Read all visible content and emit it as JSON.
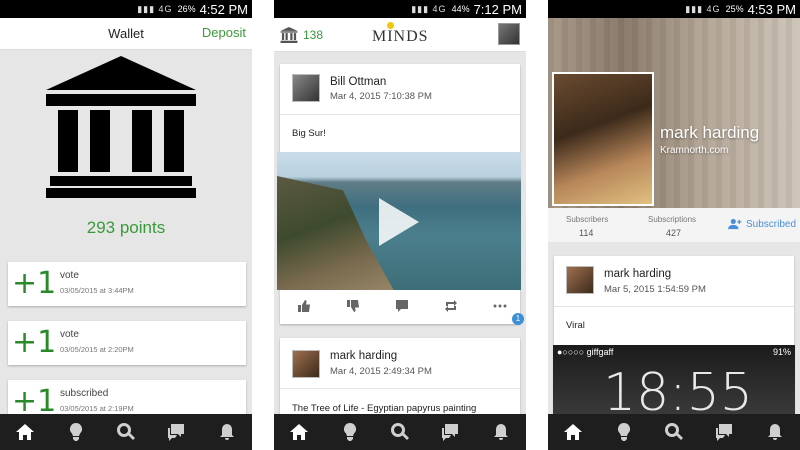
{
  "phones": [
    {
      "status": {
        "battery": "26%",
        "time": "4:52 PM"
      },
      "header": {
        "title": "Wallet",
        "deposit_label": "Deposit"
      },
      "points": "293 points",
      "transactions": [
        {
          "amount": "+1",
          "label": "vote",
          "date": "03/05/2015 at 3:44PM"
        },
        {
          "amount": "+1",
          "label": "vote",
          "date": "03/05/2015 at 2:20PM"
        },
        {
          "amount": "+1",
          "label": "subscribed",
          "date": "03/05/2015 at 2:19PM"
        }
      ]
    },
    {
      "status": {
        "battery": "44%",
        "time": "7:12 PM"
      },
      "header": {
        "points_count": "138",
        "logo": "MINDS"
      },
      "posts": [
        {
          "author": "Bill Ottman",
          "date": "Mar 4, 2015 7:10:38 PM",
          "text": "Big Sur!"
        },
        {
          "author": "mark harding",
          "date": "Mar 4, 2015 2:49:34 PM",
          "text": "The Tree of Life - Egyptian papyrus painting"
        }
      ],
      "badge_count": "1"
    },
    {
      "status": {
        "battery": "25%",
        "time": "4:53 PM"
      },
      "profile": {
        "name": "mark harding",
        "handle": "Kramnorth.com"
      },
      "stats": {
        "subscribers_label": "Subscribers",
        "subscribers_value": "114",
        "subscriptions_label": "Subscriptions",
        "subscriptions_value": "427",
        "subscribed_label": "Subscribed"
      },
      "post": {
        "author": "mark harding",
        "date": "Mar 5, 2015 1:54:59 PM",
        "text": "Viral"
      },
      "ios": {
        "carrier": "●○○○○ giffgaff",
        "battery": "91%",
        "time": "18:55"
      }
    }
  ],
  "colors": {
    "accent_green": "#3a9a3a",
    "link_blue": "#4a90d9",
    "nav_bg": "#1e1e1e"
  }
}
